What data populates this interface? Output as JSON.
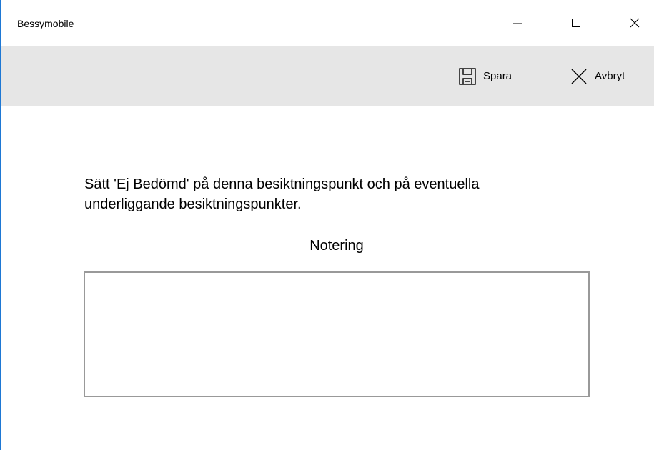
{
  "window": {
    "title": "Bessymobile",
    "controls": {
      "minimize_icon": "minimize-icon",
      "maximize_icon": "maximize-icon",
      "close_icon": "close-icon"
    }
  },
  "toolbar": {
    "save": {
      "label": "Spara",
      "icon": "save-icon"
    },
    "cancel": {
      "label": "Avbryt",
      "icon": "close-icon"
    }
  },
  "main": {
    "message": "Sätt 'Ej Bedömd' på denna besiktningspunkt och på eventuella underliggande besiktningspunkter.",
    "note_label": "Notering",
    "note_value": ""
  },
  "colors": {
    "window_border": "#1e78d4",
    "command_bar": "#e6e6e6",
    "textbox_border": "#999999"
  }
}
